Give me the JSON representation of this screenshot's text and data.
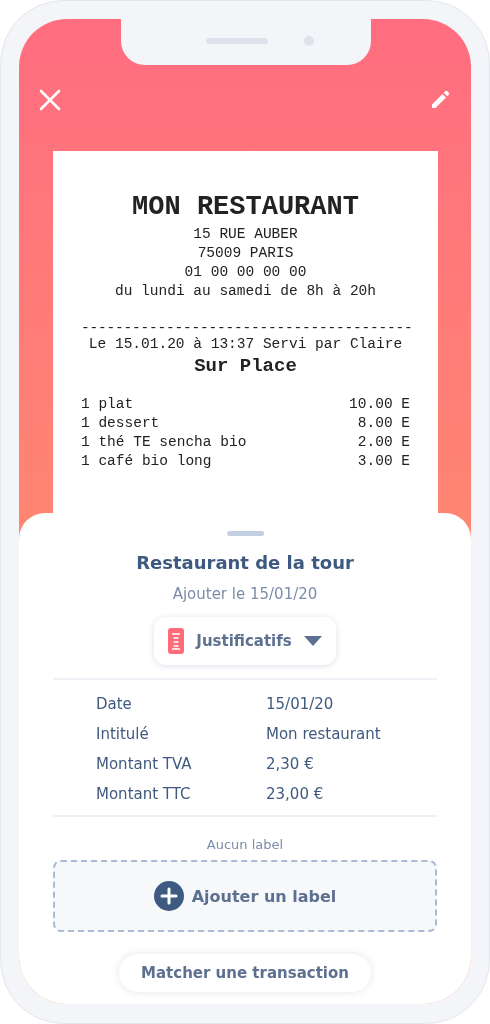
{
  "receipt": {
    "name": "MON RESTAURANT",
    "header_lines": [
      "15 RUE AUBER",
      "75009 PARIS",
      "01 00 00 00 00",
      "du lundi au samedi de 8h à 20h"
    ],
    "separator": "---------------------------------------",
    "served_line": "Le 15.01.20 à 13:37 Servi par Claire",
    "service": "Sur Place",
    "items": [
      {
        "label": "1 plat",
        "price": "10.00 E"
      },
      {
        "label": "1 dessert",
        "price": "8.00 E"
      },
      {
        "label": "1 thé TE sencha bio",
        "price": "2.00 E"
      },
      {
        "label": "1 café bio long",
        "price": "3.00 E"
      }
    ]
  },
  "sheet": {
    "title": "Restaurant de la tour",
    "subtitle": "Ajouter le 15/01/20",
    "category": "Justificatifs",
    "details": [
      {
        "label": "Date",
        "value": "15/01/20"
      },
      {
        "label": "Intitulé",
        "value": "Mon restaurant"
      },
      {
        "label": "Montant TVA",
        "value": "2,30 €"
      },
      {
        "label": "Montant TTC",
        "value": "23,00 €"
      }
    ],
    "labels_caption": "Aucun label",
    "add_label_button": "Ajouter un label",
    "match_button": "Matcher une transaction"
  }
}
